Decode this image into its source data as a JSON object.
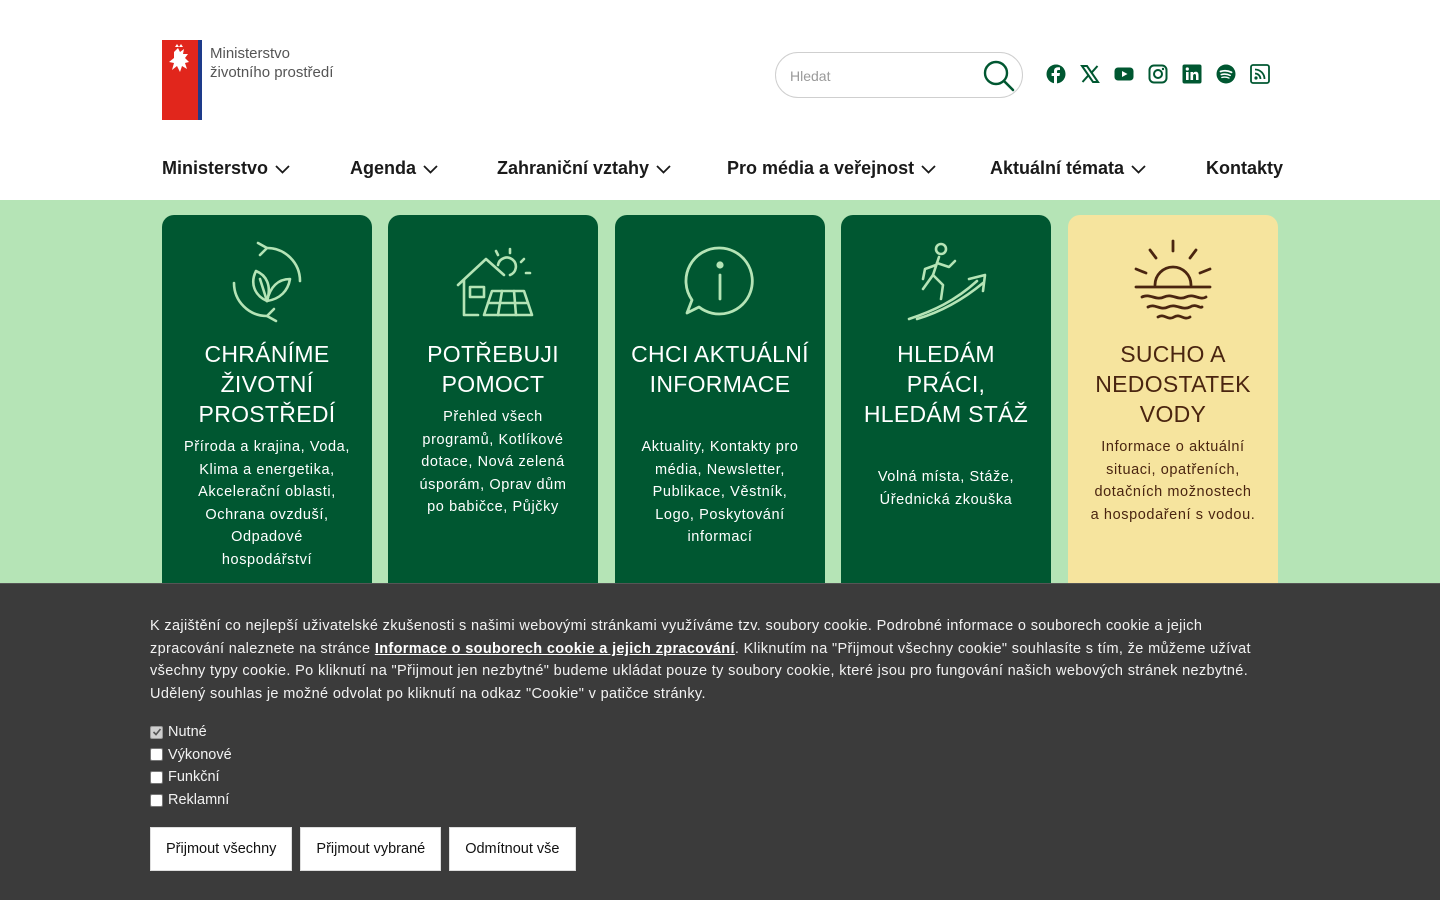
{
  "header": {
    "logo_line1": "Ministerstvo",
    "logo_line2": "životního prostředí",
    "search_placeholder": "Hledat",
    "socials": [
      "facebook-icon",
      "x-icon",
      "youtube-icon",
      "instagram-icon",
      "linkedin-icon",
      "spotify-icon",
      "rss-icon"
    ]
  },
  "nav": {
    "items": [
      {
        "label": "Ministerstvo",
        "dropdown": true
      },
      {
        "label": "Agenda",
        "dropdown": true
      },
      {
        "label": "Zahraniční vztahy",
        "dropdown": true
      },
      {
        "label": "Pro média a veřejnost",
        "dropdown": true
      },
      {
        "label": "Aktuální témata",
        "dropdown": true
      },
      {
        "label": "Kontakty",
        "dropdown": false
      }
    ]
  },
  "cards": [
    {
      "title": "CHRÁNÍME ŽIVOTNÍ PROSTŘEDÍ",
      "text": "Příroda a krajina, Voda, Klima a energetika, Akcelerační oblasti, Ochrana ovzduší, Odpadové hospodářství",
      "icon": "leaf-cycle-icon"
    },
    {
      "title": "POTŘEBUJI POMOCT",
      "text": "Přehled všech programů, Kotlíkové dotace, Nová zelená úsporám, Oprav dům po babičce, Půjčky",
      "icon": "house-solar-icon"
    },
    {
      "title": "CHCI AKTUÁLNÍ INFORMACE",
      "text": "Aktuality, Kontakty pro média, Newsletter, Publikace, Věstník, Logo, Poskytování informací",
      "icon": "info-bubble-icon"
    },
    {
      "title": "HLEDÁM PRÁCI, HLEDÁM STÁŽ",
      "text": "Volná místa, Stáže, Úřednická zkouška",
      "icon": "climbing-arrow-icon"
    },
    {
      "title": "SUCHO A NEDOSTATEK VODY",
      "text": "Informace o aktuální situaci, opatřeních, dotačních možnostech a hospodaření s vodou.",
      "icon": "sun-water-icon"
    }
  ],
  "colors": {
    "dark_green": "#005731",
    "light_green": "#b5e4b6",
    "yellow": "#f6e49e",
    "brown": "#4a2510",
    "banner_bg": "#3b3b3b"
  },
  "cookie": {
    "text_before": "K zajištění co nejlepší uživatelské zkušenosti s našimi webovými stránkami využíváme tzv. soubory cookie. Podrobné informace o souborech cookie a jejich zpracování naleznete na stránce ",
    "link": "Informace o souborech cookie a jejich zpracování",
    "text_after": ". Kliknutím na \"Přijmout všechny cookie\" souhlasíte s tím, že můžeme užívat všechny typy cookie. Po kliknutí na \"Přijmout jen nezbytné\" budeme ukládat pouze ty soubory cookie, které jsou pro fungování našich webových stránek nezbytné. Udělený souhlas je možné odvolat po kliknutí na odkaz \"Cookie\" v patičce stránky.",
    "options": [
      {
        "label": "Nutné",
        "checked": true
      },
      {
        "label": "Výkonové",
        "checked": false
      },
      {
        "label": "Funkční",
        "checked": false
      },
      {
        "label": "Reklamní",
        "checked": false
      }
    ],
    "buttons": [
      "Přijmout všechny",
      "Přijmout vybrané",
      "Odmítnout vše"
    ]
  }
}
